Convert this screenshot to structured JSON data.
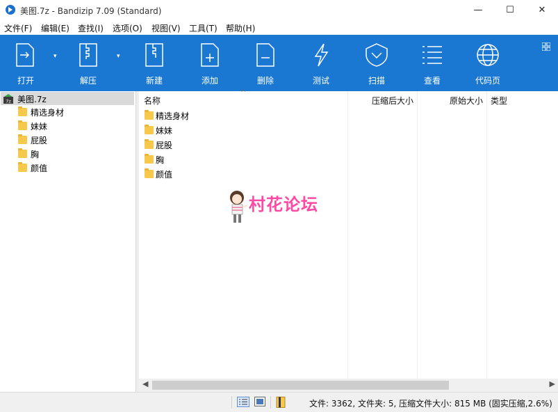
{
  "window": {
    "title": "美图.7z - Bandizip 7.09 (Standard)",
    "min": "—",
    "max": "☐",
    "close": "✕"
  },
  "menu": [
    "文件(F)",
    "编辑(E)",
    "查找(I)",
    "选项(O)",
    "视图(V)",
    "工具(T)",
    "帮助(H)"
  ],
  "toolbar": {
    "open": "打开",
    "extract": "解压",
    "new": "新建",
    "add": "添加",
    "delete": "删除",
    "test": "测试",
    "scan": "扫描",
    "view": "查看",
    "codepage": "代码页"
  },
  "tree": {
    "root": "美图.7z",
    "root_badge": "7z",
    "items": [
      "精选身材",
      "妹妹",
      "屁股",
      "胸",
      "颜值"
    ]
  },
  "columns": {
    "name": "名称",
    "packed": "压缩后大小",
    "original": "原始大小",
    "type": "类型"
  },
  "files": [
    "精选身材",
    "妹妹",
    "屁股",
    "胸",
    "颜值"
  ],
  "watermark": {
    "text": "村花论坛"
  },
  "status": {
    "text": "文件: 3362, 文件夹: 5, 压缩文件大小: 815 MB (固实压缩,2.6%)"
  },
  "colors": {
    "toolbar": "#1a78d2",
    "accent": "#ff4aa4",
    "folder": "#f6c84b"
  }
}
